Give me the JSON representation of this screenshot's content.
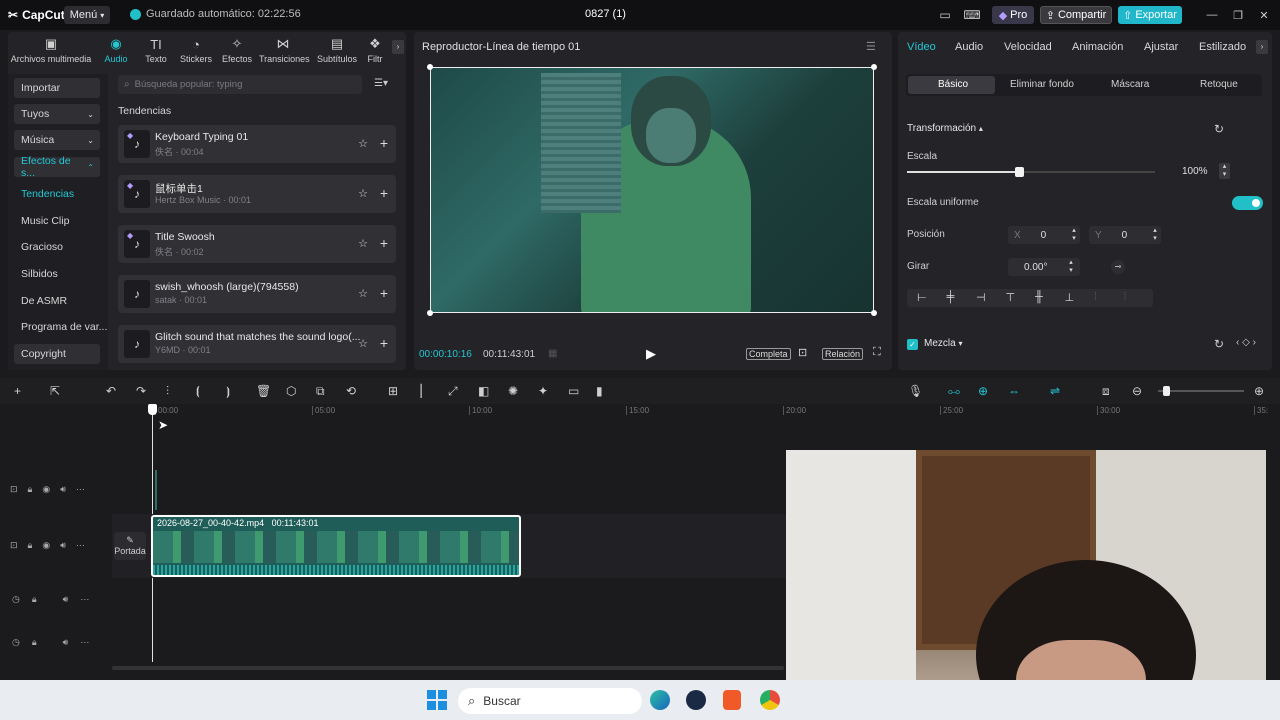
{
  "app": {
    "name": "CapCut",
    "menu": "Menú",
    "autosave": "Guardado automático: 02:22:56",
    "project": "0827 (1)",
    "pro": "Pro",
    "share": "Compartir",
    "export": "Exportar"
  },
  "toolbar": [
    {
      "label": "Archivos multimedia",
      "icon": "media-icon"
    },
    {
      "label": "Audio",
      "icon": "audio-icon",
      "active": true
    },
    {
      "label": "Texto",
      "icon": "text-icon"
    },
    {
      "label": "Stickers",
      "icon": "sticker-icon"
    },
    {
      "label": "Efectos",
      "icon": "effects-icon"
    },
    {
      "label": "Transiciones",
      "icon": "transition-icon"
    },
    {
      "label": "Subtítulos",
      "icon": "subtitle-icon"
    },
    {
      "label": "Filtr",
      "icon": "filter-icon"
    }
  ],
  "sidebar": {
    "categories": [
      {
        "label": "Importar"
      },
      {
        "label": "Tuyos"
      },
      {
        "label": "Música"
      },
      {
        "label": "Efectos de s..."
      }
    ],
    "sub": [
      "Tendencias",
      "Music Clip",
      "Gracioso",
      "Silbidos",
      "De ASMR",
      "Programa de var...",
      "Copyright"
    ]
  },
  "search": {
    "placeholder": "Búsqueda popular: typing"
  },
  "list_heading": "Tendencias",
  "sounds": [
    {
      "name": "Keyboard Typing 01",
      "meta": "佚名 · 00:04"
    },
    {
      "name": "鼠标单击1",
      "meta": "Hertz Box Music · 00:01"
    },
    {
      "name": "Title Swoosh",
      "meta": "佚名 · 00:02"
    },
    {
      "name": "swish_whoosh (large)(794558)",
      "meta": "satak · 00:01"
    },
    {
      "name": "Glitch sound that matches the sound logo(...",
      "meta": "Y6MD · 00:01"
    }
  ],
  "player": {
    "title": "Reproductor-Línea de tiempo 01",
    "current": "00:00:10:16",
    "total": "00:11:43:01",
    "complete": "Completa",
    "ratio": "Relación"
  },
  "right": {
    "tabs": [
      "Vídeo",
      "Audio",
      "Velocidad",
      "Animación",
      "Ajustar",
      "Estilizado"
    ],
    "subtabs": [
      "Básico",
      "Eliminar fondo",
      "Máscara",
      "Retoque"
    ],
    "transform": "Transformación",
    "scale_label": "Escala",
    "scale_value": "100%",
    "scale_fraction": 0.45,
    "uniform": "Escala uniforme",
    "position": "Posición",
    "x_label": "X",
    "x_value": "0",
    "y_label": "Y",
    "y_value": "0",
    "rotate": "Girar",
    "rotate_value": "0.00°",
    "blend": "Mezcla"
  },
  "timeline": {
    "ruler": [
      "00:00",
      "05:00",
      "10:00",
      "15:00",
      "20:00",
      "25:00",
      "30:00",
      "35:"
    ],
    "clip_name": "2026-08-27_00-40-42.mp4",
    "clip_duration": "00:11:43:01",
    "cover": "Portada"
  },
  "taskbar": {
    "search": "Buscar"
  },
  "colors": {
    "accent": "#21c0c8",
    "export": "#1fb7c9",
    "bg": "#1b1b1e"
  }
}
